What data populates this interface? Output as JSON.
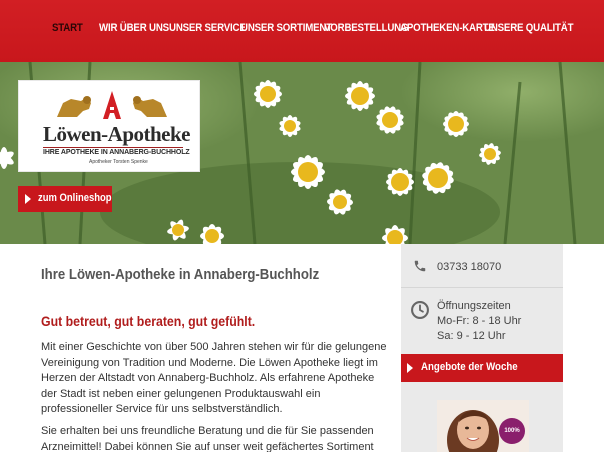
{
  "nav": {
    "items": [
      {
        "label": "START",
        "active": true
      },
      {
        "label": "WIR ÜBER UNS"
      },
      {
        "label": "UNSER SERVICE"
      },
      {
        "label": "UNSER SORTIMENT"
      },
      {
        "label": "VORBESTELLUNG"
      },
      {
        "label": "APOTHEKEN-KARTE"
      },
      {
        "label": "UNSERE QUALITÄT"
      }
    ]
  },
  "hero": {
    "logo_title": "Löwen-Apotheke",
    "logo_subtitle": "IHRE APOTHEKE IN ANNABERG-BUCHHOLZ",
    "logo_owner": "Apotheker Torsten Spenke",
    "shop_button": "zum Onlineshop"
  },
  "main": {
    "title": "Ihre Löwen-Apotheke in Annaberg-Buchholz",
    "subtitle": "Gut betreut, gut beraten, gut gefühlt.",
    "paragraph1": "Mit einer Geschichte von über 500 Jahren stehen wir für die gelungene Vereinigung von Tradition und Moderne. Die Löwen Apotheke liegt im Herzen der Altstadt von Annaberg-Buchholz. Als erfahrene Apotheke der Stadt ist neben einer gelungenen Produktauswahl ein professioneller Service für uns selbstverständlich.",
    "paragraph2": "Sie erhalten bei uns freundliche Beratung und die für Sie passenden Arzneimittel! Dabei können Sie auf unser weit gefächertes Sortiment"
  },
  "sidebar": {
    "phone": "03733 18070",
    "hours_title": "Öffnungszeiten",
    "hours_weekday": "Mo-Fr: 8 - 18 Uhr",
    "hours_saturday": "Sa: 9 - 12 Uhr",
    "offers_button": "Angebote der Woche",
    "promo_badge": "100%"
  },
  "colors": {
    "brand_red": "#c8171c",
    "nav_active": "#2a0606",
    "heading_red": "#b01c1c",
    "sidebar_bg": "#eaeaea"
  }
}
